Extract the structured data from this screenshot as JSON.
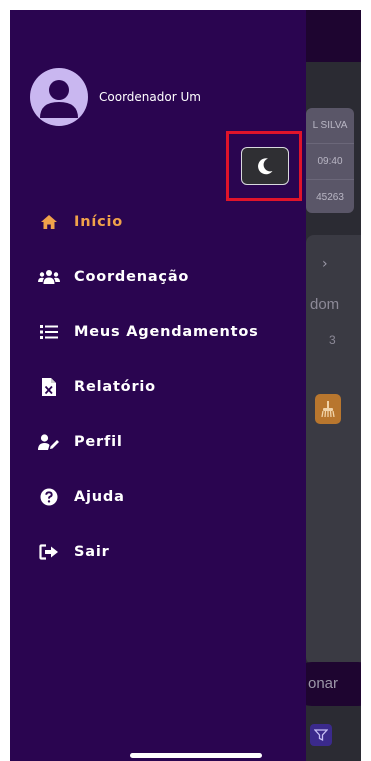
{
  "background": {
    "card_rows": [
      "L SILVA",
      "09:40",
      "45263"
    ],
    "day_label": "dom",
    "day_number": "3",
    "action_button": "onar"
  },
  "drawer": {
    "user_name": "Coordenador Um",
    "theme_toggle_icon": "moon-icon",
    "items": [
      {
        "label": "Início",
        "icon": "home-icon",
        "active": true
      },
      {
        "label": "Coordenação",
        "icon": "users-icon",
        "active": false
      },
      {
        "label": "Meus Agendamentos",
        "icon": "list-icon",
        "active": false
      },
      {
        "label": "Relatório",
        "icon": "excel-file-icon",
        "active": false
      },
      {
        "label": "Perfil",
        "icon": "user-edit-icon",
        "active": false
      },
      {
        "label": "Ajuda",
        "icon": "question-icon",
        "active": false
      },
      {
        "label": "Sair",
        "icon": "logout-icon",
        "active": false
      }
    ]
  },
  "colors": {
    "drawer_bg": "#2a0550",
    "active_accent": "#f0a24a",
    "highlight_box": "#e0142a"
  }
}
